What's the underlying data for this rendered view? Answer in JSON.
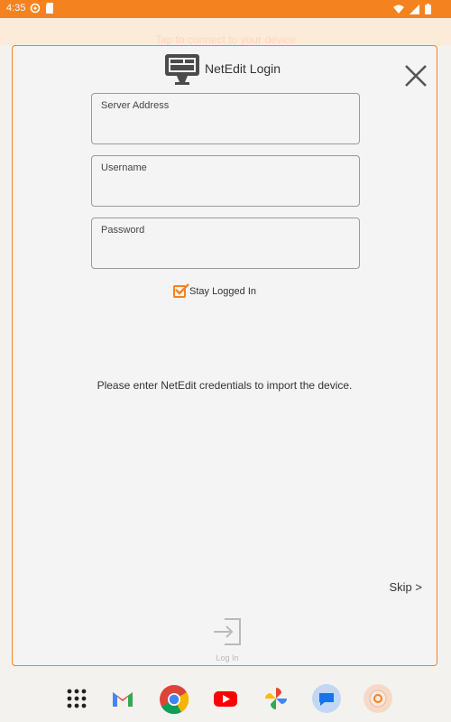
{
  "status_bar": {
    "time": "4:35",
    "icons_left": [
      "settings-gear-icon",
      "sd-card-icon"
    ],
    "icons_right": [
      "wifi-icon",
      "signal-icon",
      "battery-icon"
    ]
  },
  "background": {
    "banner_text": "Tap to connect to your device"
  },
  "dialog": {
    "title": "NetEdit Login",
    "server_field": {
      "label": "Server Address",
      "value": ""
    },
    "username_field": {
      "label": "Username",
      "value": ""
    },
    "password_field": {
      "label": "Password",
      "value": ""
    },
    "stay_logged_in": {
      "label": "Stay Logged In",
      "checked": true
    },
    "info": "Please enter NetEdit credentials to import the device.",
    "skip_label": "Skip >",
    "login_label": "Log In"
  },
  "dock": {
    "apps": [
      "app-drawer-icon",
      "gmail-icon",
      "chrome-icon",
      "youtube-icon",
      "photos-icon",
      "messages-icon",
      "app-icon"
    ]
  },
  "colors": {
    "accent": "#f4831f",
    "dialog_bg": "#f4f4f4",
    "field_border": "#9a9a9a"
  }
}
